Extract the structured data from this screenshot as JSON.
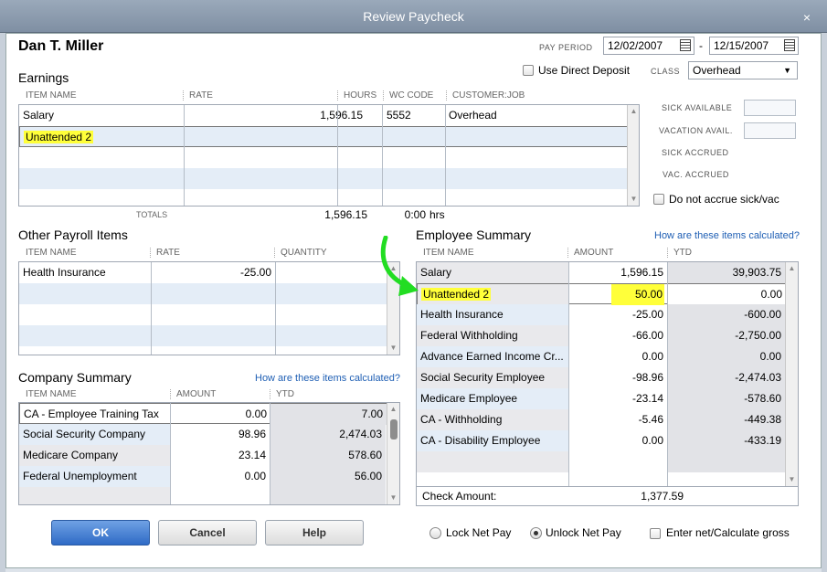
{
  "window": {
    "title": "Review Paycheck",
    "close_icon": "×"
  },
  "employee_name": "Dan T. Miller",
  "pay_period": {
    "label": "PAY PERIOD",
    "start": "12/02/2007",
    "separator": "-",
    "end": "12/15/2007"
  },
  "direct_deposit": {
    "label": "Use Direct Deposit",
    "checked": false
  },
  "class": {
    "label": "CLASS",
    "value": "Overhead"
  },
  "earnings": {
    "title": "Earnings",
    "headers": {
      "item": "ITEM NAME",
      "rate": "RATE",
      "hours": "HOURS",
      "wc": "WC CODE",
      "job": "CUSTOMER:JOB"
    },
    "rows": [
      {
        "item": "Salary",
        "rate": "1,596.15",
        "hours": "",
        "wc": "5552",
        "job": "Overhead"
      },
      {
        "item": "Unattended 2",
        "rate": "",
        "hours": "",
        "wc": "",
        "job": ""
      }
    ],
    "totals_label": "TOTALS",
    "total_rate": "1,596.15",
    "total_hours": "0:00",
    "hours_unit": "hrs"
  },
  "sick_vac": {
    "sick_available": "SICK AVAILABLE",
    "vacation_avail": "VACATION AVAIL.",
    "sick_accrued": "SICK ACCRUED",
    "vac_accrued": "VAC. ACCRUED",
    "do_not_accrue": "Do not accrue sick/vac"
  },
  "other_payroll": {
    "title": "Other Payroll Items",
    "headers": {
      "item": "ITEM NAME",
      "rate": "RATE",
      "quantity": "QUANTITY"
    },
    "rows": [
      {
        "item": "Health Insurance",
        "rate": "-25.00",
        "quantity": ""
      }
    ]
  },
  "employee_summary": {
    "title": "Employee Summary",
    "link": "How are these items calculated?",
    "headers": {
      "item": "ITEM NAME",
      "amount": "AMOUNT",
      "ytd": "YTD"
    },
    "rows": [
      {
        "item": "Salary",
        "amount": "1,596.15",
        "ytd": "39,903.75"
      },
      {
        "item": "Unattended 2",
        "amount": "50.00",
        "ytd": "0.00"
      },
      {
        "item": "Health Insurance",
        "amount": "-25.00",
        "ytd": "-600.00"
      },
      {
        "item": "Federal Withholding",
        "amount": "-66.00",
        "ytd": "-2,750.00"
      },
      {
        "item": "Advance Earned Income Cr...",
        "amount": "0.00",
        "ytd": "0.00"
      },
      {
        "item": "Social Security Employee",
        "amount": "-98.96",
        "ytd": "-2,474.03"
      },
      {
        "item": "Medicare Employee",
        "amount": "-23.14",
        "ytd": "-578.60"
      },
      {
        "item": "CA - Withholding",
        "amount": "-5.46",
        "ytd": "-449.38"
      },
      {
        "item": "CA - Disability Employee",
        "amount": "0.00",
        "ytd": "-433.19"
      }
    ],
    "check_amount_label": "Check Amount:",
    "check_amount": "1,377.59"
  },
  "company_summary": {
    "title": "Company Summary",
    "link": "How are these items calculated?",
    "headers": {
      "item": "ITEM NAME",
      "amount": "AMOUNT",
      "ytd": "YTD"
    },
    "rows": [
      {
        "item": "CA - Employee Training Tax",
        "amount": "0.00",
        "ytd": "7.00"
      },
      {
        "item": "Social Security Company",
        "amount": "98.96",
        "ytd": "2,474.03"
      },
      {
        "item": "Medicare Company",
        "amount": "23.14",
        "ytd": "578.60"
      },
      {
        "item": "Federal Unemployment",
        "amount": "0.00",
        "ytd": "56.00"
      }
    ]
  },
  "buttons": {
    "ok": "OK",
    "cancel": "Cancel",
    "help": "Help"
  },
  "net_pay": {
    "lock": "Lock Net Pay",
    "unlock": "Unlock Net Pay",
    "enter_net": "Enter net/Calculate gross",
    "selected": "unlock"
  },
  "colors": {
    "highlight": "#ffff3a",
    "arrow": "#22dd22",
    "link": "#1f5fb4",
    "ok_button": "#2f6bc6"
  }
}
